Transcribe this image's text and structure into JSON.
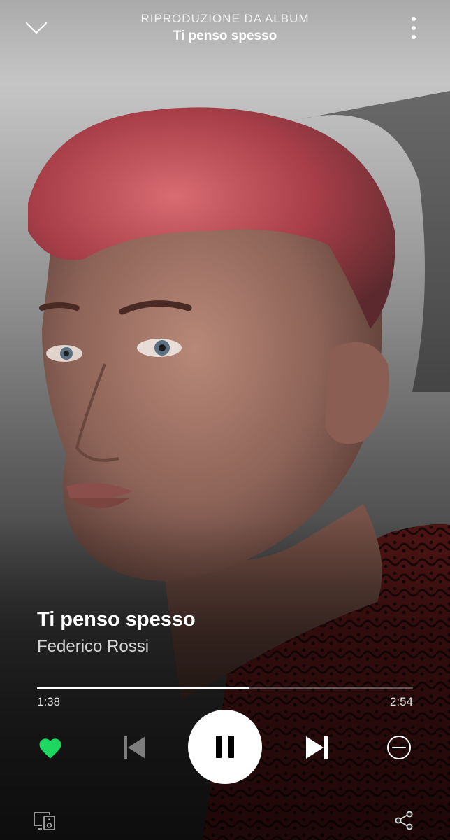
{
  "header": {
    "context_label": "RIPRODUZIONE DA ALBUM",
    "album_title": "Ti penso spesso"
  },
  "track": {
    "title": "Ti penso spesso",
    "artist": "Federico Rossi",
    "liked": true
  },
  "playback": {
    "elapsed": "1:38",
    "duration": "2:54",
    "progress_fraction": 0.563,
    "state": "playing"
  },
  "icons": {
    "collapse": "chevron-down-icon",
    "more": "more-vertical-icon",
    "like": "heart-icon",
    "previous": "skip-previous-icon",
    "pause": "pause-icon",
    "next": "skip-next-icon",
    "hide": "minus-circle-icon",
    "devices": "devices-icon",
    "share": "share-icon"
  },
  "colors": {
    "accent_green": "#1ed760",
    "text_white": "#ffffff",
    "text_muted": "#d4d4d4",
    "progress_track": "#6b6b6b",
    "play_button_bg": "#ffffff",
    "play_button_icon": "#000000"
  }
}
